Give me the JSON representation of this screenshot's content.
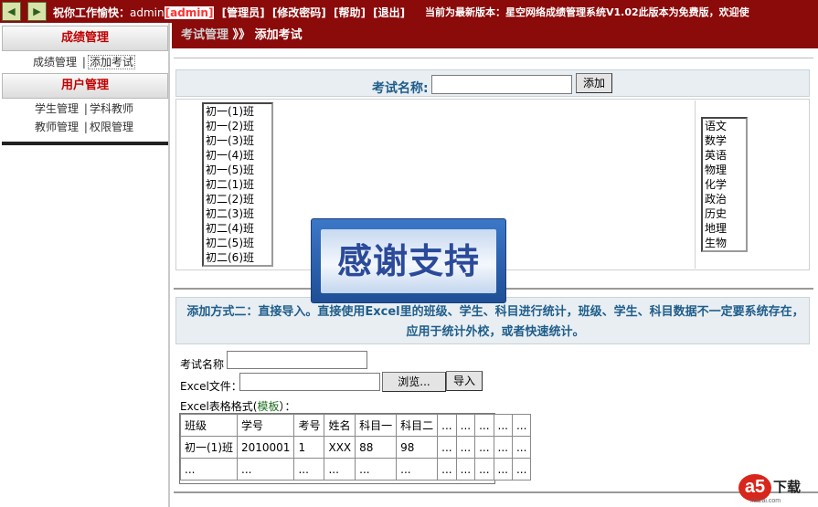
{
  "topbar": {
    "greeting": "祝你工作愉快：",
    "username": "admin",
    "role": "[admin]",
    "links": [
      "[管理员]",
      "[修改密码]",
      "[帮助]",
      "[退出]"
    ],
    "notice": "当前为最新版本：星空网络成绩管理系统V1.02此版本为免费版，欢迎使"
  },
  "sidebar": {
    "sections": [
      {
        "title": "成绩管理",
        "links": [
          "成绩管理",
          "添加考试"
        ]
      },
      {
        "title": "用户管理",
        "links": [
          "学生管理",
          "学科教师",
          "教师管理",
          "权限管理"
        ]
      }
    ],
    "separator": "|"
  },
  "breadcrumb": {
    "parent": "考试管理",
    "arrow": "》》",
    "current": "添加考试"
  },
  "exam_form": {
    "name_label": "考试名称:",
    "name_value": "",
    "add_button": "添加"
  },
  "classes": [
    "初一(1)班",
    "初一(2)班",
    "初一(3)班",
    "初一(4)班",
    "初一(5)班",
    "初二(1)班",
    "初二(2)班",
    "初二(3)班",
    "初二(4)班",
    "初二(5)班",
    "初二(6)班"
  ],
  "subjects": [
    "语文",
    "数学",
    "英语",
    "物理",
    "化学",
    "政治",
    "历史",
    "地理",
    "生物"
  ],
  "watermark": "感谢支持",
  "method2": {
    "description": "添加方式二：直接导入。直接使用Excel里的班级、学生、科目进行统计，班级、学生、科目数据不一定要系统存在，应用于统计外校，或者快速统计。",
    "exam_name_label": "考试名称",
    "exam_name_value": "",
    "excel_label": "Excel文件：",
    "excel_value": "",
    "browse_button": "浏览...",
    "import_button": "导入",
    "format_label": "Excel表格格式(",
    "template_link": "模板",
    "format_suffix": "）："
  },
  "sample_table": {
    "headers": [
      "班级",
      "学号",
      "考号",
      "姓名",
      "科目一",
      "科目二",
      "...",
      "...",
      "...",
      "...",
      "..."
    ],
    "rows": [
      [
        "初一(1)班",
        "2010001",
        "1",
        "XXX",
        "88",
        "98",
        "...",
        "...",
        "...",
        "...",
        "..."
      ],
      [
        "...",
        "...",
        "...",
        "...",
        "...",
        "...",
        "...",
        "...",
        "...",
        "...",
        "..."
      ]
    ]
  },
  "site_logo": {
    "badge": "a5",
    "text": "下载",
    "sub": "xiazai.com"
  }
}
